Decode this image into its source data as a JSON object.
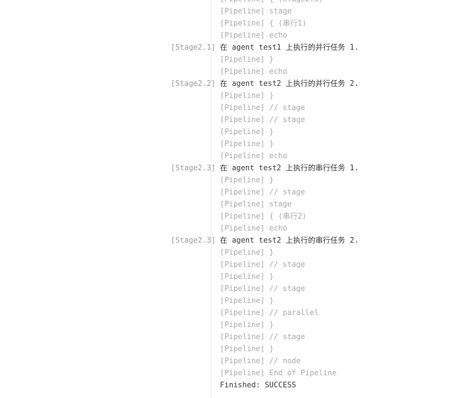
{
  "console": {
    "lines": [
      {
        "label": "",
        "text": "[Pipeline] { (Stage2.3)",
        "muted": true
      },
      {
        "label": "",
        "text": "[Pipeline] stage",
        "muted": true
      },
      {
        "label": "",
        "text": "[Pipeline] { (串行1)",
        "muted": true
      },
      {
        "label": "",
        "text": "[Pipeline] echo",
        "muted": true
      },
      {
        "label": "[Stage2.1]",
        "text": "在 agent test1 上执行的并行任务 1.",
        "muted": false
      },
      {
        "label": "",
        "text": "[Pipeline] }",
        "muted": true
      },
      {
        "label": "",
        "text": "[Pipeline] echo",
        "muted": true
      },
      {
        "label": "[Stage2.2]",
        "text": "在 agent test2 上执行的并行任务 2.",
        "muted": false
      },
      {
        "label": "",
        "text": "[Pipeline] }",
        "muted": true
      },
      {
        "label": "",
        "text": "[Pipeline] // stage",
        "muted": true
      },
      {
        "label": "",
        "text": "[Pipeline] // stage",
        "muted": true
      },
      {
        "label": "",
        "text": "[Pipeline] }",
        "muted": true
      },
      {
        "label": "",
        "text": "[Pipeline] }",
        "muted": true
      },
      {
        "label": "",
        "text": "[Pipeline] echo",
        "muted": true
      },
      {
        "label": "[Stage2.3]",
        "text": "在 agent test2 上执行的串行任务 1.",
        "muted": false
      },
      {
        "label": "",
        "text": "[Pipeline] }",
        "muted": true
      },
      {
        "label": "",
        "text": "[Pipeline] // stage",
        "muted": true
      },
      {
        "label": "",
        "text": "[Pipeline] stage",
        "muted": true
      },
      {
        "label": "",
        "text": "[Pipeline] { (串行2)",
        "muted": true
      },
      {
        "label": "",
        "text": "[Pipeline] echo",
        "muted": true
      },
      {
        "label": "[Stage2.3]",
        "text": "在 agent test2 上执行的串行任务 2.",
        "muted": false
      },
      {
        "label": "",
        "text": "[Pipeline] }",
        "muted": true
      },
      {
        "label": "",
        "text": "[Pipeline] // stage",
        "muted": true
      },
      {
        "label": "",
        "text": "[Pipeline] }",
        "muted": true
      },
      {
        "label": "",
        "text": "[Pipeline] // stage",
        "muted": true
      },
      {
        "label": "",
        "text": "[Pipeline] }",
        "muted": true
      },
      {
        "label": "",
        "text": "[Pipeline] // parallel",
        "muted": true
      },
      {
        "label": "",
        "text": "[Pipeline] }",
        "muted": true
      },
      {
        "label": "",
        "text": "[Pipeline] // stage",
        "muted": true
      },
      {
        "label": "",
        "text": "[Pipeline] }",
        "muted": true
      },
      {
        "label": "",
        "text": "[Pipeline] // node",
        "muted": true
      },
      {
        "label": "",
        "text": "[Pipeline] End of Pipeline",
        "muted": true
      },
      {
        "label": "",
        "text": "Finished: SUCCESS",
        "muted": false
      }
    ]
  }
}
